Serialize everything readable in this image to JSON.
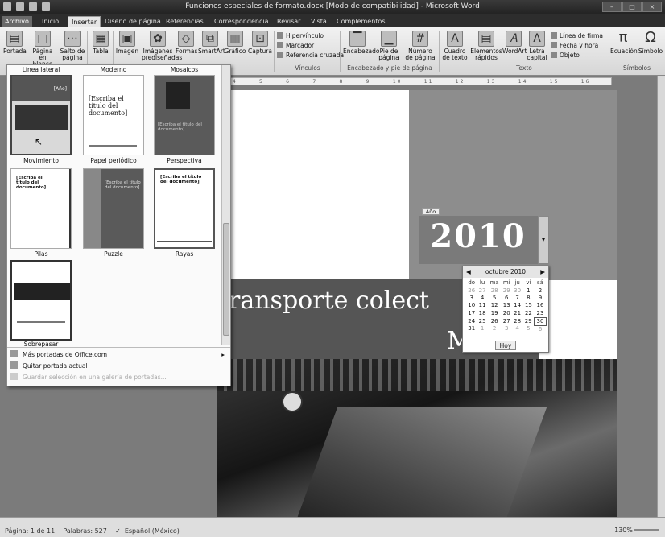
{
  "window": {
    "title": "Funciones especiales de formato.docx [Modo de compatibilidad] - Microsoft Word"
  },
  "tabs": [
    "Archivo",
    "Inicio",
    "Insertar",
    "Diseño de página",
    "Referencias",
    "Correspondencia",
    "Revisar",
    "Vista",
    "Complementos"
  ],
  "ribbon": {
    "paginas": [
      {
        "label": "Portada",
        "icon": "cover-page-icon"
      },
      {
        "label": "Página en blanco",
        "icon": "blank-page-icon"
      },
      {
        "label": "Salto de página",
        "icon": "page-break-icon"
      }
    ],
    "tabla": {
      "label": "Tabla",
      "icon": "table-icon"
    },
    "ilustraciones": [
      {
        "label": "Imagen",
        "icon": "picture-icon"
      },
      {
        "label": "Imágenes prediseñadas",
        "icon": "clipart-icon"
      },
      {
        "label": "Formas",
        "icon": "shapes-icon"
      },
      {
        "label": "SmartArt",
        "icon": "smartart-icon"
      },
      {
        "label": "Gráfico",
        "icon": "chart-icon"
      },
      {
        "label": "Captura",
        "icon": "screenshot-icon"
      }
    ],
    "vinculos": {
      "items": [
        "Hipervínculo",
        "Marcador",
        "Referencia cruzada"
      ],
      "group_label": "Vínculos"
    },
    "encabezado": {
      "items": [
        "Encabezado",
        "Pie de página",
        "Número de página"
      ],
      "group_label": "Encabezado y pie de página"
    },
    "texto": {
      "items": [
        "Cuadro de texto",
        "Elementos rápidos",
        "WordArt",
        "Letra capital"
      ],
      "small": [
        "Línea de firma",
        "Fecha y hora",
        "Objeto"
      ],
      "group_label": "Texto"
    },
    "simbolos": {
      "items": [
        {
          "label": "Ecuación",
          "glyph": "π"
        },
        {
          "label": "Símbolo",
          "glyph": "Ω"
        }
      ],
      "group_label": "Símbolos"
    }
  },
  "gallery": {
    "columns": [
      "Línea lateral",
      "Moderno",
      "Mosaicos"
    ],
    "thumbs": [
      {
        "label": "Movimiento",
        "text": "[Año]"
      },
      {
        "label": "Papel periódico",
        "text": "[Escriba el título del documento]"
      },
      {
        "label": "Perspectiva",
        "text": "[Escriba el título del documento]"
      },
      {
        "label": "Pilas",
        "text": "[Escriba el título del documento]"
      },
      {
        "label": "Puzzle",
        "text": "[Escriba el título del documento]"
      },
      {
        "label": "Rayas",
        "text": "[Escriba el título del documento]"
      },
      {
        "label": "Sobrepasar",
        "text": ""
      }
    ],
    "menu": [
      {
        "label": "Más portadas de Office.com",
        "enabled": true
      },
      {
        "label": "Quitar portada actual",
        "enabled": true
      },
      {
        "label": "Guardar selección en una galería de portadas...",
        "enabled": false
      }
    ]
  },
  "document": {
    "year_tag": "Año",
    "year": "2010",
    "title_line1": "ransporte colect",
    "title_line2": "M"
  },
  "calendar": {
    "month": "octubre 2010",
    "weekdays": [
      "do",
      "lu",
      "ma",
      "mi",
      "ju",
      "vi",
      "sá"
    ],
    "weeks": [
      [
        "26",
        "27",
        "28",
        "29",
        "30",
        "1",
        "2"
      ],
      [
        "3",
        "4",
        "5",
        "6",
        "7",
        "8",
        "9"
      ],
      [
        "10",
        "11",
        "12",
        "13",
        "14",
        "15",
        "16"
      ],
      [
        "17",
        "18",
        "19",
        "20",
        "21",
        "22",
        "23"
      ],
      [
        "24",
        "25",
        "26",
        "27",
        "28",
        "29",
        "30"
      ],
      [
        "31",
        "1",
        "2",
        "3",
        "4",
        "5",
        "6"
      ]
    ],
    "today_button": "Hoy"
  },
  "status": {
    "page": "Página: 1 de 11",
    "words": "Palabras: 527",
    "language": "Español (México)",
    "zoom": "130%"
  }
}
